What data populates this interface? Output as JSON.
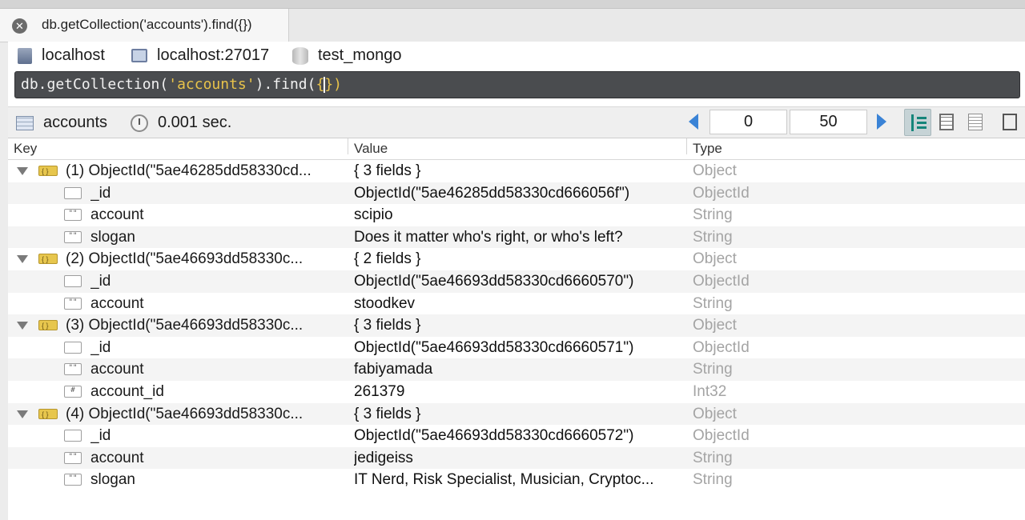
{
  "tab": {
    "label": "db.getCollection('accounts').find({})"
  },
  "connection": {
    "host": "localhost",
    "server": "localhost:27017",
    "database": "test_mongo"
  },
  "query": {
    "prefix": "db.getCollection(",
    "string": "'accounts'",
    "mid": ").find(",
    "open": "{",
    "close": "})"
  },
  "results_bar": {
    "collection": "accounts",
    "time": "0.001 sec.",
    "page_start": "0",
    "page_size": "50"
  },
  "columns": {
    "key": "Key",
    "value": "Value",
    "type": "Type"
  },
  "rows": [
    {
      "kind": "parent",
      "key": "(1) ObjectId(\"5ae46285dd58330cd...",
      "value": "{ 3 fields }",
      "type": "Object"
    },
    {
      "kind": "child",
      "icon": "",
      "key": "_id",
      "value": "ObjectId(\"5ae46285dd58330cd666056f\")",
      "type": "ObjectId"
    },
    {
      "kind": "child",
      "icon": "\"\"",
      "key": "account",
      "value": "scipio",
      "type": "String"
    },
    {
      "kind": "child",
      "icon": "\"\"",
      "key": "slogan",
      "value": "Does it matter who's right, or who's left?",
      "type": "String"
    },
    {
      "kind": "parent",
      "key": "(2) ObjectId(\"5ae46693dd58330c...",
      "value": "{ 2 fields }",
      "type": "Object"
    },
    {
      "kind": "child",
      "icon": "",
      "key": "_id",
      "value": "ObjectId(\"5ae46693dd58330cd6660570\")",
      "type": "ObjectId"
    },
    {
      "kind": "child",
      "icon": "\"\"",
      "key": "account",
      "value": "stoodkev",
      "type": "String"
    },
    {
      "kind": "parent",
      "key": "(3) ObjectId(\"5ae46693dd58330c...",
      "value": "{ 3 fields }",
      "type": "Object"
    },
    {
      "kind": "child",
      "icon": "",
      "key": "_id",
      "value": "ObjectId(\"5ae46693dd58330cd6660571\")",
      "type": "ObjectId"
    },
    {
      "kind": "child",
      "icon": "\"\"",
      "key": "account",
      "value": "fabiyamada",
      "type": "String"
    },
    {
      "kind": "child",
      "icon": "#",
      "key": "account_id",
      "value": "261379",
      "type": "Int32"
    },
    {
      "kind": "parent",
      "key": "(4) ObjectId(\"5ae46693dd58330c...",
      "value": "{ 3 fields }",
      "type": "Object"
    },
    {
      "kind": "child",
      "icon": "",
      "key": "_id",
      "value": "ObjectId(\"5ae46693dd58330cd6660572\")",
      "type": "ObjectId"
    },
    {
      "kind": "child",
      "icon": "\"\"",
      "key": "account",
      "value": "jedigeiss",
      "type": "String"
    },
    {
      "kind": "child",
      "icon": "\"\"",
      "key": "slogan",
      "value": "IT Nerd, Risk Specialist, Musician, Cryptoc...",
      "type": "String"
    }
  ]
}
